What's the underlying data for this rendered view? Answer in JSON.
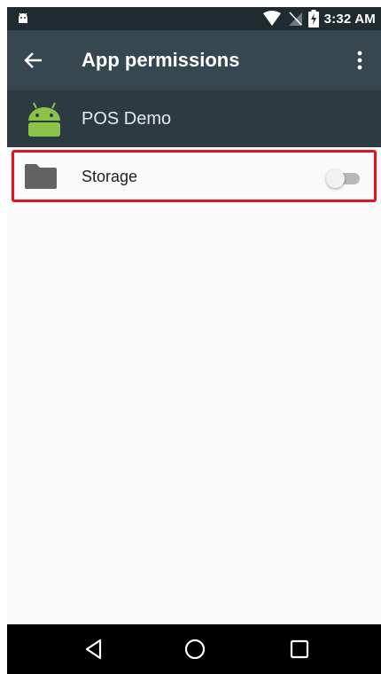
{
  "status_bar": {
    "time": "3:32 AM",
    "icons": [
      "android-notification-icon",
      "wifi-icon",
      "no-sim-icon",
      "battery-charging-icon"
    ]
  },
  "toolbar": {
    "title": "App permissions",
    "back_icon": "arrow-left-icon",
    "more_icon": "more-vert-icon"
  },
  "app": {
    "name": "POS Demo",
    "icon": "android-robot-icon",
    "icon_color": "#8bc34a"
  },
  "permissions": [
    {
      "label": "Storage",
      "icon": "folder-icon",
      "enabled": false,
      "highlighted": true
    }
  ],
  "colors": {
    "status_bar": "#1f2b30",
    "toolbar": "#36474f",
    "app_header": "#2c3b42",
    "highlight": "#e8101a",
    "background": "#fafafa"
  },
  "nav_bar": {
    "buttons": [
      "back-triangle-icon",
      "home-circle-icon",
      "recents-square-icon"
    ]
  }
}
